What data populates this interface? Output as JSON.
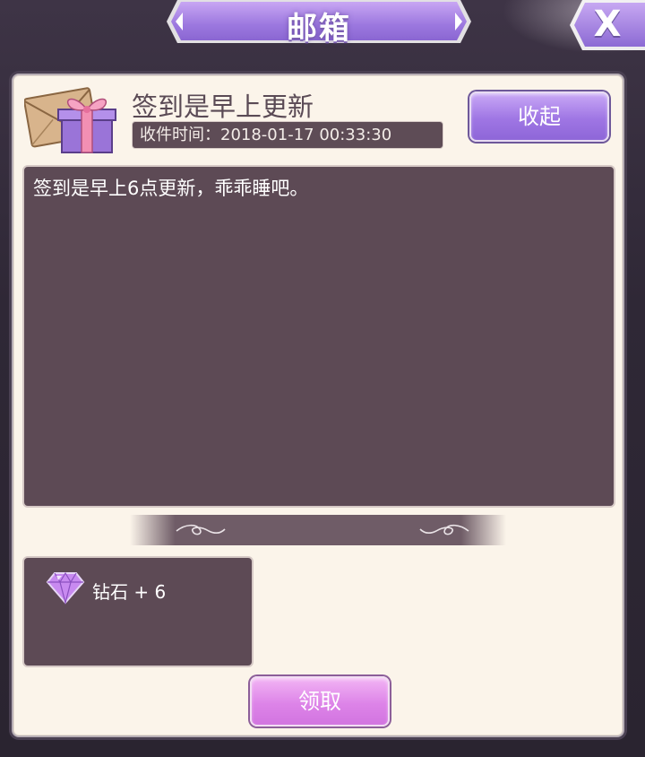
{
  "header": {
    "title": "邮箱",
    "close_label": "X"
  },
  "mail": {
    "subject": "签到是早上更新",
    "received_time": "收件时间：2018-01-17 00:33:30",
    "collapse_label": "收起",
    "body": "签到是早上6点更新，乖乖睡吧。"
  },
  "attachment": {
    "icon": "diamond-icon",
    "label": "钻石 + 6"
  },
  "actions": {
    "claim_label": "领取"
  },
  "colors": {
    "panel": "#fbf4ea",
    "content_bg": "#5d4a55",
    "collapse_button": "#a27ce5",
    "claim_button": "#dd84e8"
  }
}
